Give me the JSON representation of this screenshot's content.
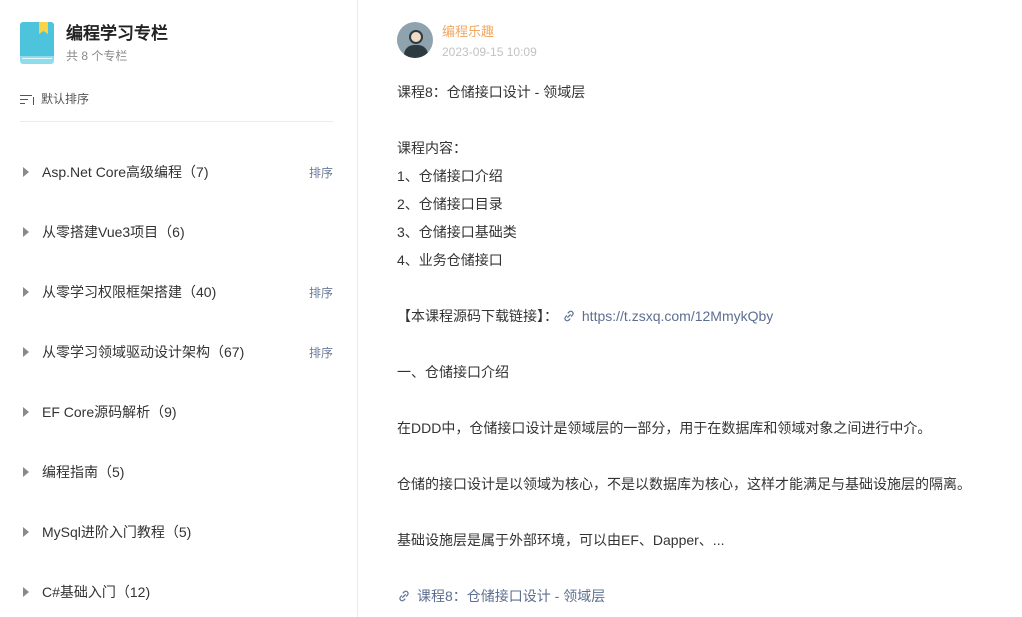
{
  "sidebar": {
    "title": "编程学习专栏",
    "count_text": "共 8 个专栏",
    "sort_label": "默认排序",
    "items": [
      {
        "label": "Asp.Net Core高级编程（7)",
        "sort": "排序"
      },
      {
        "label": "从零搭建Vue3项目（6)",
        "sort": ""
      },
      {
        "label": "从零学习权限框架搭建（40)",
        "sort": "排序"
      },
      {
        "label": "从零学习领域驱动设计架构（67)",
        "sort": "排序"
      },
      {
        "label": "EF Core源码解析（9)",
        "sort": ""
      },
      {
        "label": "编程指南（5)",
        "sort": ""
      },
      {
        "label": "MySql进阶入门教程（5)",
        "sort": ""
      },
      {
        "label": "C#基础入门（12)",
        "sort": ""
      }
    ]
  },
  "article": {
    "author_name": "编程乐趣",
    "time": "2023-09-15 10:09",
    "title_line": "课程8：仓储接口设计 - 领域层",
    "content_heading": "课程内容：",
    "outline": [
      "1、仓储接口介绍",
      "2、仓储接口目录",
      "3、仓储接口基础类",
      "4、业务仓储接口"
    ],
    "source_label": "【本课程源码下载链接】：",
    "source_url": "https://t.zsxq.com/12MmykQby",
    "section_heading": "一、仓储接口介绍",
    "para1": "在DDD中，仓储接口设计是领域层的一部分，用于在数据库和领域对象之间进行中介。",
    "para2": "仓储的接口设计是以领域为核心，不是以数据库为核心，这样才能满足与基础设施层的隔离。",
    "para3": "基础设施层是属于外部环境，可以由EF、Dapper、...",
    "footer_link": "课程8：仓储接口设计 - 领域层"
  },
  "colors": {
    "accent_orange": "#f0a862",
    "link": "#5d6f91",
    "book_icon": "#4ec4dc"
  },
  "icons": {
    "column": "book-icon",
    "sort": "sort-icon",
    "expand": "caret-right-icon",
    "link": "link-icon",
    "avatar": "avatar"
  }
}
